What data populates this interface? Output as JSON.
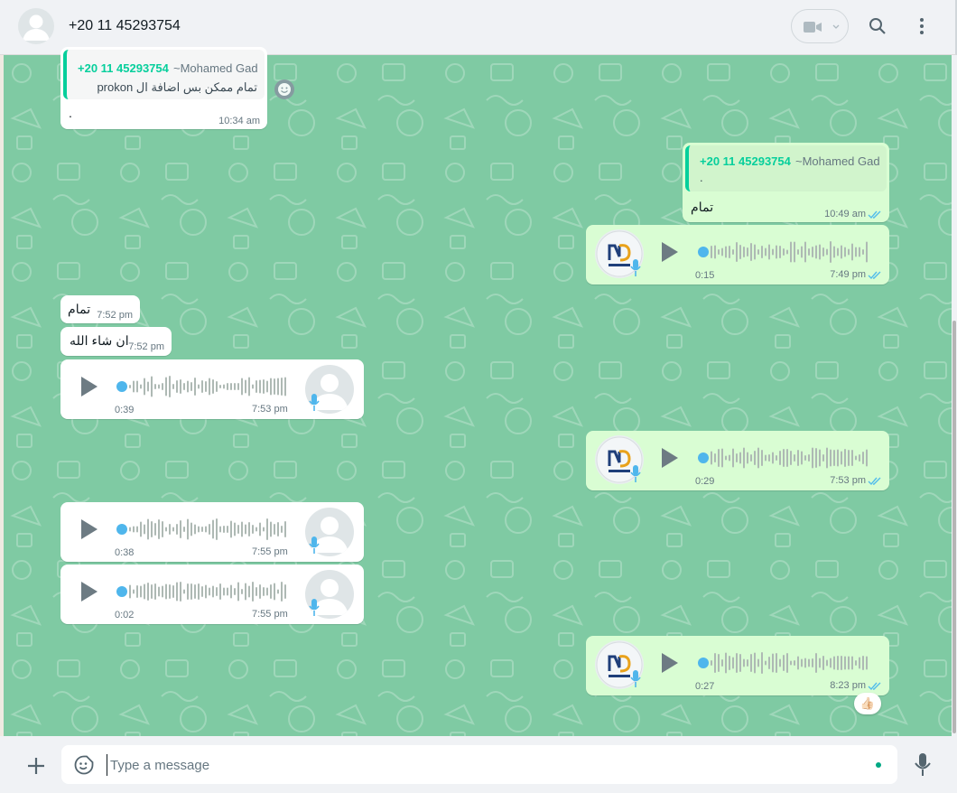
{
  "header": {
    "contact_name": "+20 11 45293754",
    "icons": [
      "default-avatar-icon",
      "video-call-icon",
      "chevron-down-icon",
      "search-icon",
      "kebab-menu-icon"
    ]
  },
  "messages": {
    "m1": {
      "quote_number": "+20 11 45293754",
      "quote_name": "~Mohamed Gad",
      "quote_text": "تمام ممكن بس اضافة ال prokon",
      "text": ".",
      "time": "10:34 am"
    },
    "m2": {
      "quote_number": "+20 11 45293754",
      "quote_name": "~Mohamed Gad",
      "quote_text": ".",
      "text": "تمام",
      "time": "10:49 am"
    },
    "v1": {
      "duration": "0:15",
      "time": "7:49 pm"
    },
    "t1": {
      "text": "تمام",
      "time": "7:52 pm"
    },
    "t2": {
      "text": "ان شاء الله",
      "time": "7:52 pm"
    },
    "v2": {
      "duration": "0:39",
      "time": "7:53 pm"
    },
    "v3": {
      "duration": "0:29",
      "time": "7:53 pm"
    },
    "v4": {
      "duration": "0:38",
      "time": "7:55 pm"
    },
    "v5": {
      "duration": "0:02",
      "time": "7:55 pm"
    },
    "v6": {
      "duration": "0:27",
      "time": "8:23 pm",
      "reaction": "👍🏻"
    }
  },
  "composer": {
    "placeholder": "Type a message"
  },
  "colors": {
    "chat_background": "#7fcaa3",
    "outgoing_bubble": "#d9fdd3",
    "incoming_bubble": "#ffffff",
    "accent_green": "#06cf9c",
    "read_ticks": "#53bdeb",
    "waveform_dot": "#4fb6ec"
  }
}
